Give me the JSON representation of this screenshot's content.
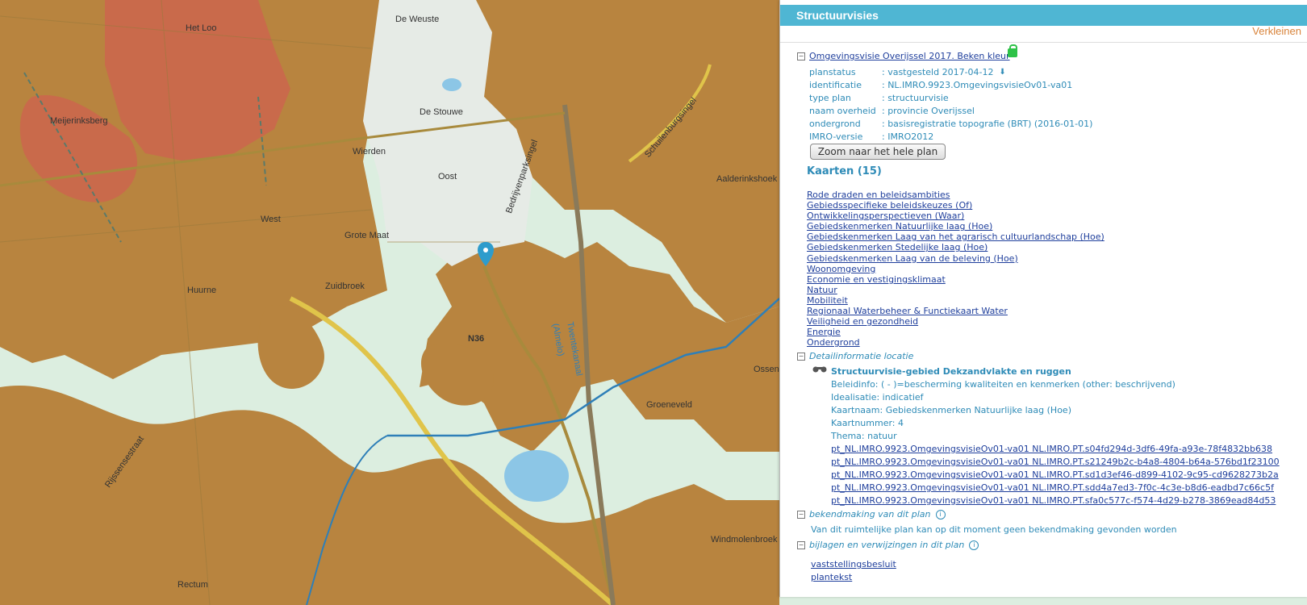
{
  "map": {
    "labels": {
      "het_loo": "Het Loo",
      "de_weuste": "De Weuste",
      "meijerinksberg": "Meijerinksberg",
      "de_stouwe": "De Stouwe",
      "wierden": "Wierden",
      "oost": "Oost",
      "west": "West",
      "grote_maat": "Grote Maat",
      "huurne": "Huurne",
      "zuidbroek": "Zuidbroek",
      "bedrijvenparksingel": "Bedrijvenparksingel",
      "schuilenburgsingel": "Schuilenburgsingel",
      "aalderinkshoek": "Aalderinkshoek",
      "n36": "N36",
      "twentekanaal": "Twentekanaal",
      "almelo": "(Almelo)",
      "ossen": "Ossen",
      "groeneveld": "Groeneveld",
      "rijssensestraat": "Rijssensestraat",
      "windmolenbroek": "Windmolenbroek",
      "rectum": "Rectum"
    },
    "colors": {
      "base": "#dceee0",
      "brown": "#b8843f",
      "red": "#c96a4b",
      "water": "#2e7fb8"
    }
  },
  "panel": {
    "title": "Structuurvisies",
    "collapse_label": "Verkleinen",
    "plan": {
      "title": "Omgevingsvisie Overijssel 2017. Beken kleur",
      "meta": [
        {
          "key": "planstatus",
          "value": ": vastgesteld 2017-04-12"
        },
        {
          "key": "identificatie",
          "value": ": NL.IMRO.9923.OmgevingsvisieOv01-va01"
        },
        {
          "key": "type plan",
          "value": ": structuurvisie"
        },
        {
          "key": "naam overheid",
          "value": ": provincie Overijssel"
        },
        {
          "key": "ondergrond",
          "value": ": basisregistratie topografie (BRT) (2016-01-01)"
        },
        {
          "key": "IMRO-versie",
          "value": ": IMRO2012"
        }
      ],
      "zoom_button": "Zoom naar het hele plan"
    },
    "maps": {
      "heading": "Kaarten (15)",
      "items": [
        "Rode draden en beleidsambities",
        "Gebiedsspecifieke beleidskeuzes (Of)",
        "Ontwikkelingsperspectieven (Waar)",
        "Gebiedskenmerken Natuurlijke laag (Hoe)",
        "Gebiedskenmerken Laag van het agrarisch cultuurlandschap (Hoe)",
        "Gebiedskenmerken Stedelijke laag (Hoe)",
        "Gebiedskenmerken Laag van de beleving (Hoe)",
        "Woonomgeving",
        "Economie en vestigingsklimaat",
        "Natuur",
        "Mobiliteit",
        "Regionaal Waterbeheer & Functiekaart Water",
        "Veiligheid en gezondheid",
        "Energie",
        "Ondergrond"
      ]
    },
    "detail": {
      "section_title": "Detailinformatie locatie",
      "object_title": "Structuurvisie-gebied Dekzandvlakte en ruggen",
      "lines": [
        "Beleidinfo: ( - )=bescherming kwaliteiten en kenmerken (other: beschrijvend)",
        "Idealisatie: indicatief",
        "Kaartnaam: Gebiedskenmerken Natuurlijke laag (Hoe)",
        "Kaartnummer: 4",
        "Thema: natuur"
      ],
      "links": [
        "pt_NL.IMRO.9923.OmgevingsvisieOv01-va01 NL.IMRO.PT.s04fd294d-3df6-49fa-a93e-78f4832bb638",
        "pt_NL.IMRO.9923.OmgevingsvisieOv01-va01 NL.IMRO.PT.s21249b2c-b4a8-4804-b64a-576bd1f23100",
        "pt_NL.IMRO.9923.OmgevingsvisieOv01-va01 NL.IMRO.PT.sd1d3ef46-d899-4102-9c95-cd9628273b2a",
        "pt_NL.IMRO.9923.OmgevingsvisieOv01-va01 NL.IMRO.PT.sdd4a7ed3-7f0c-4c3e-b8d6-eadbd7c66c5f",
        "pt_NL.IMRO.9923.OmgevingsvisieOv01-va01 NL.IMRO.PT.sfa0c577c-f574-4d29-b278-3869ead84d53"
      ]
    },
    "announcement": {
      "section_title": "bekendmaking van dit plan",
      "text": "Van dit ruimtelijke plan kan op dit moment geen bekendmaking gevonden worden"
    },
    "attachments": {
      "section_title": "bijlagen en verwijzingen in dit plan",
      "links": [
        "vaststellingsbesluit",
        "plantekst"
      ]
    }
  }
}
